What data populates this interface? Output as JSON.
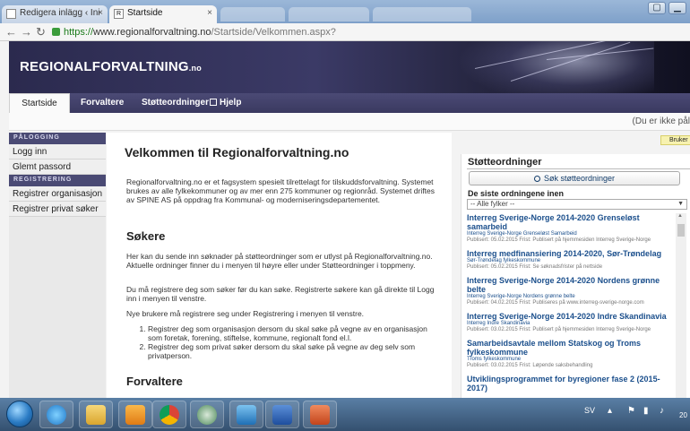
{
  "browser": {
    "tabs": [
      {
        "label": "Redigera inlägg ‹ Ini",
        "active": false
      },
      {
        "label": "Startside",
        "active": true
      }
    ],
    "close_glyph": "×",
    "url_scheme": "https://",
    "url_host": "www.regionalforvaltning.no",
    "url_path": "/Startside/Velkommen.aspx?"
  },
  "site": {
    "logo_main": "REGIONALFORVALTNING",
    "logo_suffix": ".no",
    "nav": [
      "Startside",
      "Forvaltere",
      "Støtteordninger",
      "Hjelp"
    ],
    "login_status": "(Du er ikke pål"
  },
  "sidebar": {
    "sections": [
      {
        "heading": "PÅLOGGING",
        "items": [
          "Logg inn",
          "Glemt passord"
        ]
      },
      {
        "heading": "REGISTRERING",
        "items": [
          "Registrer organisasjon",
          "Registrer privat søker"
        ]
      }
    ]
  },
  "main": {
    "title": "Velkommen til Regionalforvaltning.no",
    "intro": "Regionalforvaltning.no er et fagsystem spesielt tilrettelagt for tilskuddsforvaltning. Systemet brukes av alle fylkekommuner og av mer enn 275 kommuner og regionråd. Systemet driftes av SPINE AS på oppdrag fra Kommunal- og moderniseringsdepartementet.",
    "sokere_heading": "Søkere",
    "sokere_p1": "Her kan du sende inn søknader på støtteordninger som er utlyst på Regionalforvaltning.no. Aktuelle ordninger finner du i menyen til høyre eller under Støtteordninger i toppmeny.",
    "sokere_p2": "Du må registrere deg som søker før du kan søke. Registrerte søkere kan gå direkte til Logg inn i menyen til venstre.",
    "sokere_p3": "Nye brukere må registrere seg under Registrering i menyen til venstre.",
    "list": [
      "Registrer deg som organisasjon dersom du skal søke på vegne av en organisasjon som foretak, forening, stiftelse, kommune, regionalt fond el.l.",
      "Registrer deg som privat søker dersom du skal søke på vegne av deg selv som privatperson."
    ],
    "forvaltere_heading": "Forvaltere"
  },
  "right": {
    "help_tag": "Bruker",
    "title": "Støtteordninger",
    "search_button": "Søk støtteordninger",
    "latest_heading": "De siste ordningene inen",
    "filter_selected": "-- Alle fylker --",
    "items": [
      {
        "title": "Interreg Sverige-Norge 2014-2020 Grenseløst samarbeid",
        "org": "Interreg Sverige-Norge Grenseløst Samarbeid",
        "published": "Publisert: 05.02.2015 Frist: Publisert på hjemmesiden Interreg Sverige-Norge"
      },
      {
        "title": "Interreg medfinansiering 2014-2020, Sør-Trøndelag",
        "org": "Sør-Trøndelag fylkeskommune",
        "published": "Publisert: 05.02.2015 Frist: Se søknadsfrister på nettside"
      },
      {
        "title": "Interreg Sverige-Norge 2014-2020 Nordens grønne belte",
        "org": "Interreg Sverige-Norge Nordens grønne belte",
        "published": "Publisert: 04.02.2015 Frist: Publiseres på www.interreg-sverige-norge.com"
      },
      {
        "title": "Interreg Sverige-Norge 2014-2020 Indre Skandinavia",
        "org": "Interreg Indre Skandinavia",
        "published": "Publisert: 03.02.2015 Frist: Publisert på hjemmesiden Interreg Sverige-Norge"
      },
      {
        "title": "Samarbeidsavtale mellom Statskog og Troms fylkeskommune",
        "org": "Troms fylkeskommune",
        "published": "Publisert: 03.02.2015 Frist: Løpende saksbehandling"
      },
      {
        "title": "Utviklingsprogrammet for byregioner fase 2 (2015-2017)",
        "org": "",
        "published": ""
      }
    ]
  },
  "taskbar": {
    "language": "SV",
    "clock": "20",
    "apps": [
      "internet-explorer-icon",
      "file-explorer-icon",
      "outlook-icon",
      "chrome-icon",
      "network-icon",
      "lync-icon",
      "word-icon",
      "powerpoint-icon"
    ]
  },
  "colors": {
    "nav_bg": "#3f3e68",
    "link": "#1b4f8c",
    "accent_green": "#1a7a1a"
  }
}
